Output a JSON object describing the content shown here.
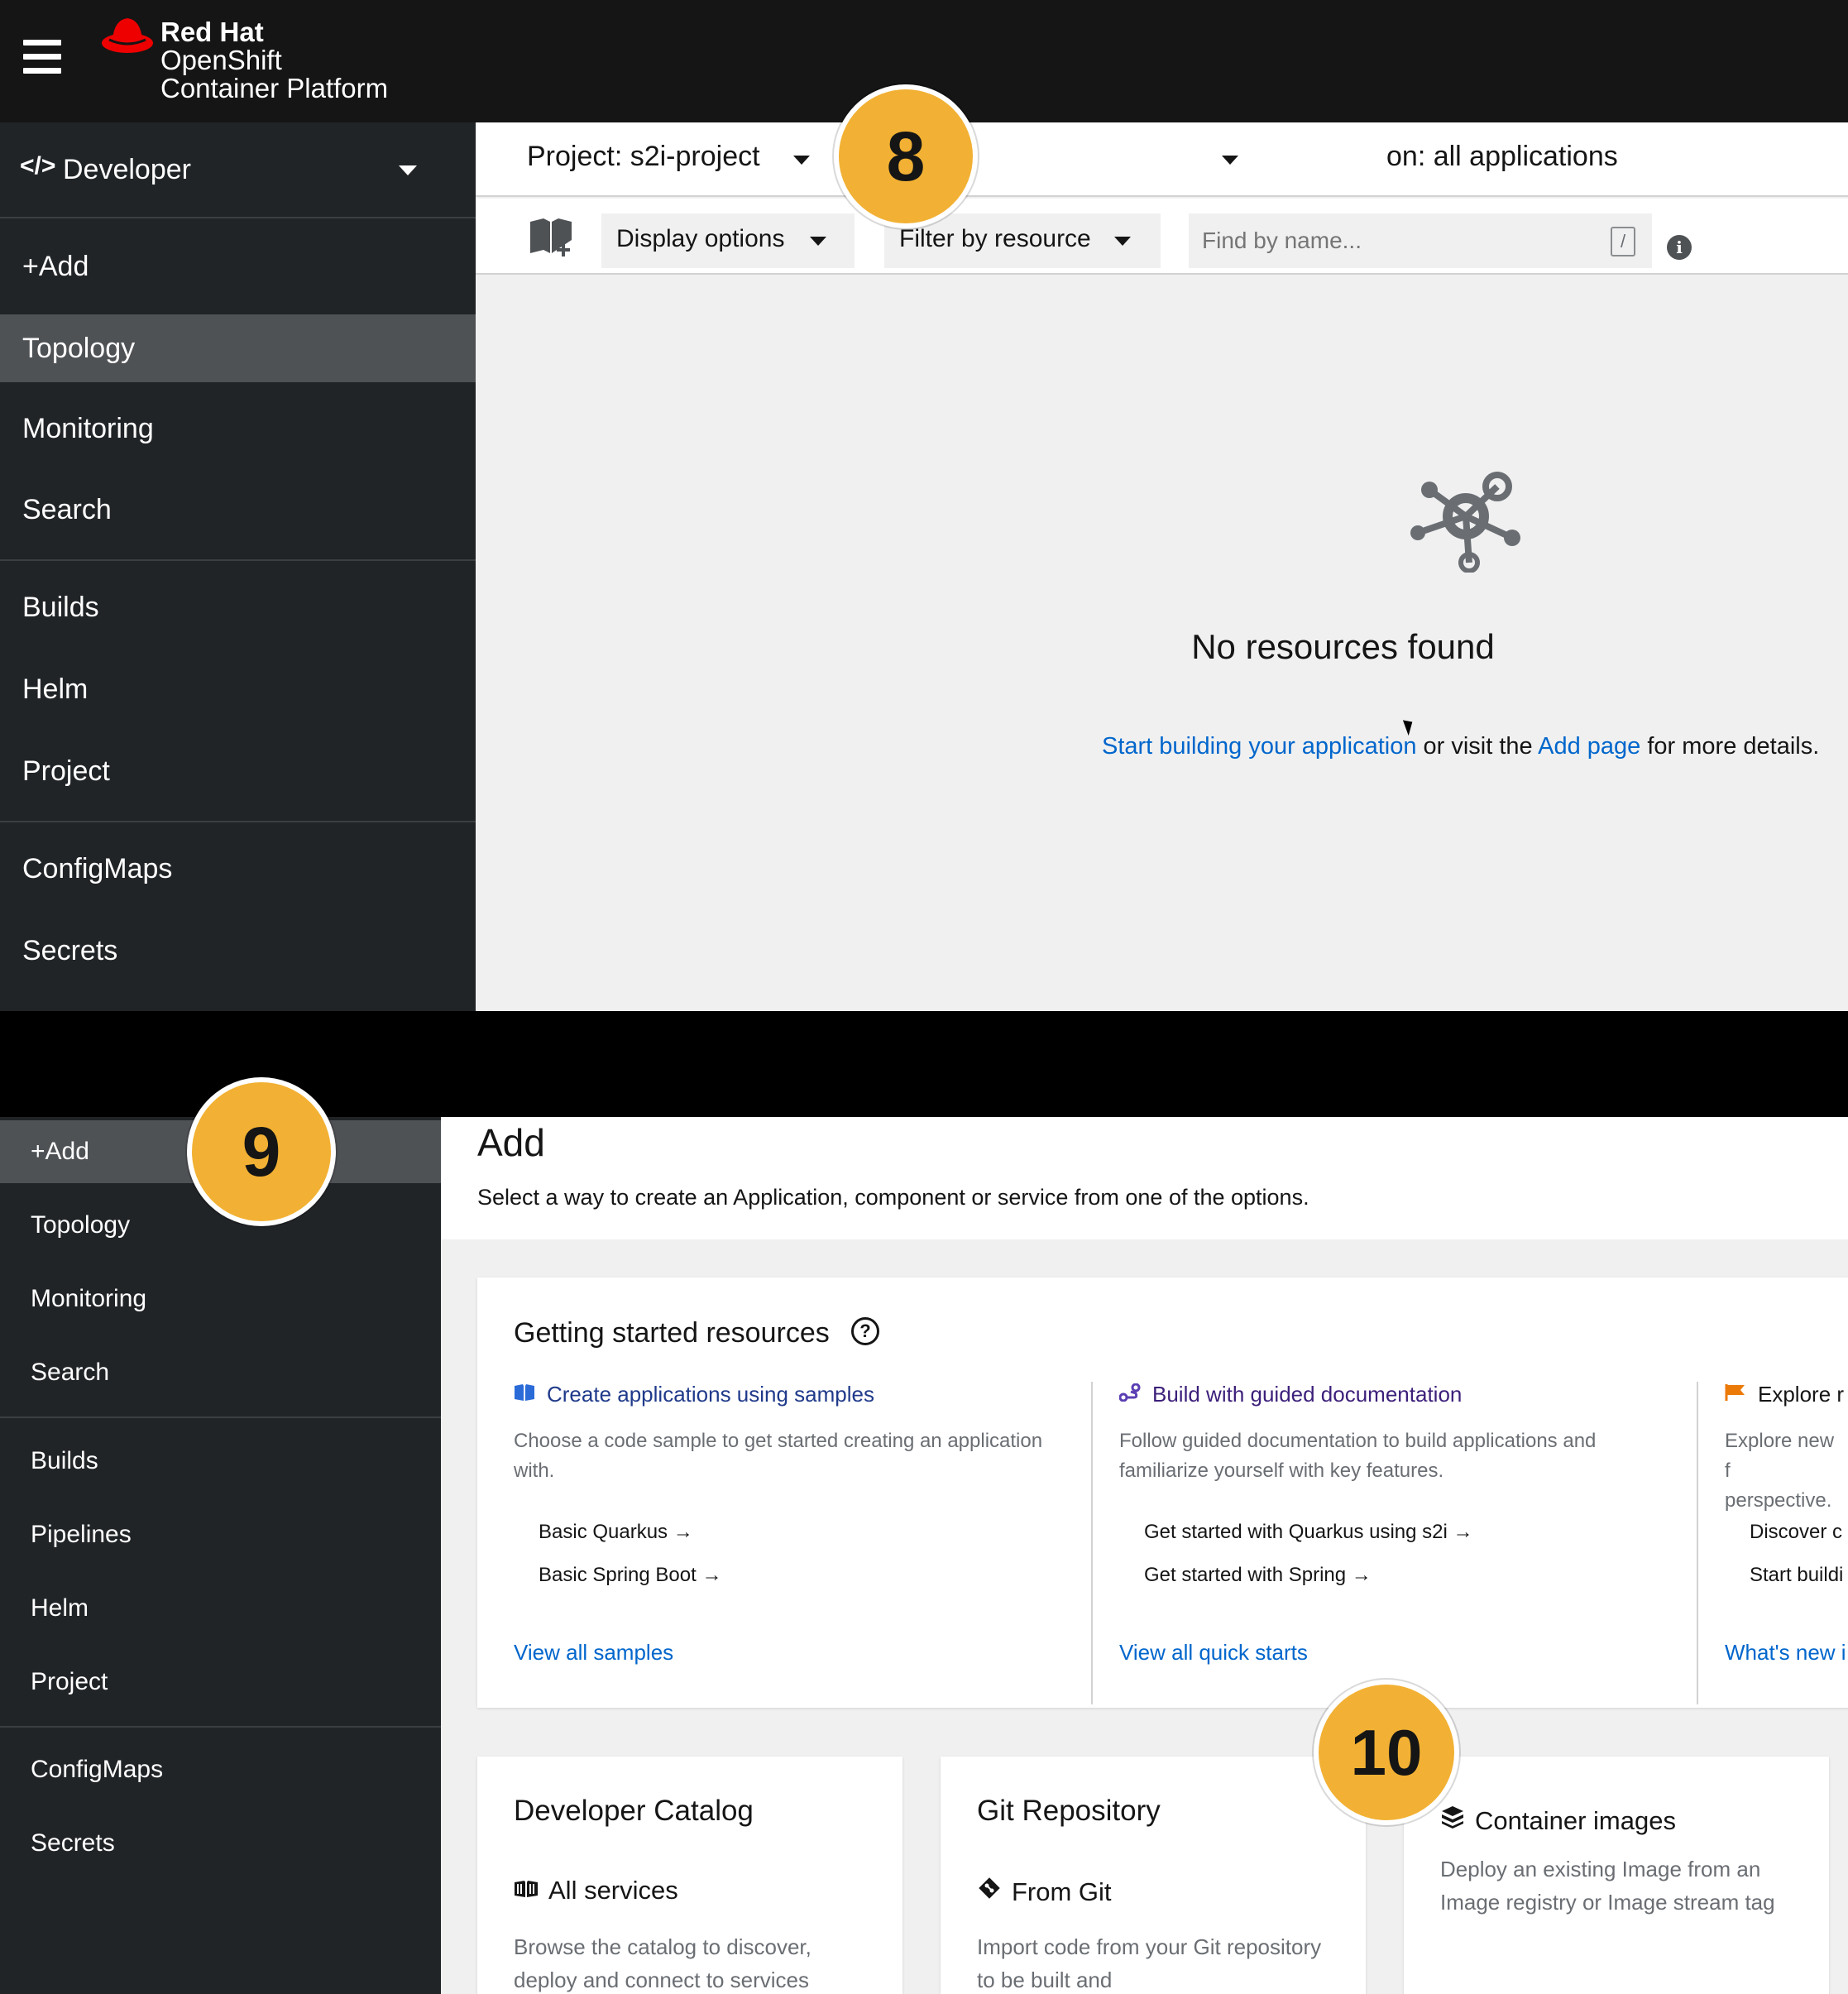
{
  "brand": {
    "line1": "Red Hat",
    "line2": "OpenShift",
    "line3": "Container Platform",
    "hat_color": "#ee0000"
  },
  "top": {
    "perspective": "Developer",
    "nav": [
      "+Add",
      "Topology",
      "Monitoring",
      "Search",
      "Builds",
      "Helm",
      "Project",
      "ConfigMaps",
      "Secrets"
    ],
    "active_nav": "Topology",
    "project_selector": "Project: s2i-project",
    "application_selector": "on: all applications",
    "toolbar": {
      "display_options": "Display options",
      "filter_by_resource": "Filter by resource",
      "find_placeholder": "Find by name...",
      "shortcut_key": "/"
    },
    "empty_state": {
      "icon": "topology-icon",
      "title": "No resources found",
      "link1": "Start building your application",
      "text1": " or visit the ",
      "link2": "Add page",
      "text2": " for more details."
    }
  },
  "badges": [
    "8",
    "9",
    "10"
  ],
  "bottom": {
    "nav": [
      "+Add",
      "Topology",
      "Monitoring",
      "Search",
      "Builds",
      "Pipelines",
      "Helm",
      "Project",
      "ConfigMaps",
      "Secrets"
    ],
    "active_nav": "+Add",
    "header": {
      "title": "Add",
      "subtitle": "Select a way to create an Application, component or service from one of the options."
    },
    "getting_started": {
      "title": "Getting started resources",
      "columns": [
        {
          "title": "Create applications using samples",
          "title_color": "#1f3a8a",
          "icon": "book-icon",
          "description": "Choose a code sample to get started creating an application with.",
          "links": [
            "Basic Quarkus →",
            "Basic Spring Boot →"
          ],
          "view_all": "View all samples"
        },
        {
          "title": "Build with guided documentation",
          "title_color": "#3c1f7a",
          "icon": "route-icon",
          "description": "Follow guided documentation to build applications and familiarize yourself with key features.",
          "links": [
            "Get started with Quarkus using s2i →",
            "Get started with Spring →"
          ],
          "view_all": "View all quick starts"
        },
        {
          "title": "Explore r",
          "title_color": "#151515",
          "icon": "flag-icon",
          "description": "Explore new f perspective.",
          "links": [
            "Discover c",
            "Start buildi"
          ],
          "view_all": "What's new i"
        }
      ]
    },
    "cards": [
      {
        "title": "Developer Catalog",
        "item": "All services",
        "item_icon": "catalog-icon",
        "description": "Browse the catalog to discover, deploy and connect to services"
      },
      {
        "title": "Git Repository",
        "item": "From Git",
        "item_icon": "git-icon",
        "description": "Import code from your Git repository to be built and"
      },
      {
        "title": "",
        "item": "Container images",
        "item_icon": "cube-icon",
        "description": "Deploy an existing Image from an Image registry or Image stream tag"
      }
    ]
  }
}
